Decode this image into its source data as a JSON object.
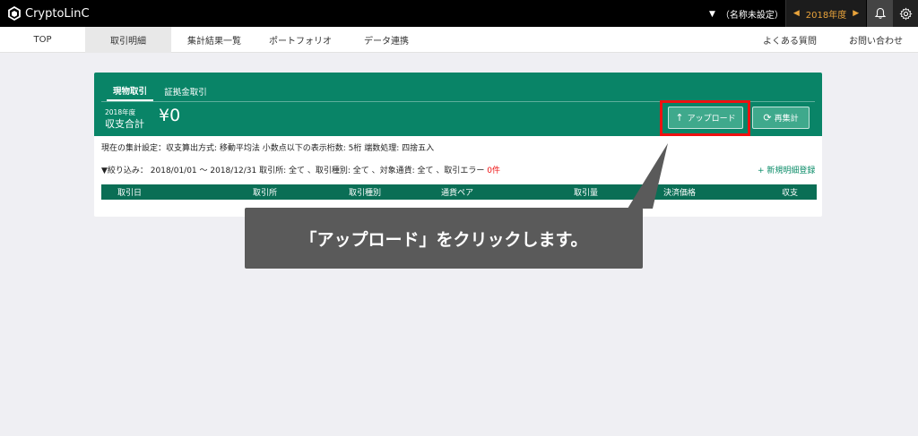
{
  "app": {
    "brand": "CryptoLinC",
    "user_name": "（名称未設定）",
    "year": "2018年度"
  },
  "nav": {
    "items": [
      "TOP",
      "取引明細",
      "集計結果一覧",
      "ポートフォリオ",
      "データ連携"
    ],
    "active_index": 1,
    "right_items": [
      "よくある質問",
      "お問い合わせ"
    ]
  },
  "card": {
    "tabs": [
      "現物取引",
      "証拠金取引"
    ],
    "active_tab": 0,
    "year_label": "2018年度",
    "total_label": "収支合計",
    "total_value": "¥0",
    "upload_label": "アップロード",
    "recalc_label": "再集計",
    "settings_text": "現在の集計設定：収支算出方式: 移動平均法  小数点以下の表示桁数: 5桁  端数処理: 四捨五入",
    "filter_text": "▼絞り込み： 2018/01/01 〜 2018/12/31 取引所: 全て 、取引種別: 全て 、対象通貨: 全て 、取引エラー",
    "filter_error_count": "0件",
    "new_link": "+ 新規明細登録",
    "columns": [
      "取引日",
      "取引所",
      "取引種別",
      "通貨ペア",
      "取引量",
      "決済価格",
      "収支"
    ]
  },
  "callout": {
    "text": "「アップロード」をクリックします。"
  },
  "colors": {
    "brand_green": "#098467",
    "table_header": "#0a6e55",
    "highlight": "#e11111",
    "year_accent": "#e9a33b"
  }
}
